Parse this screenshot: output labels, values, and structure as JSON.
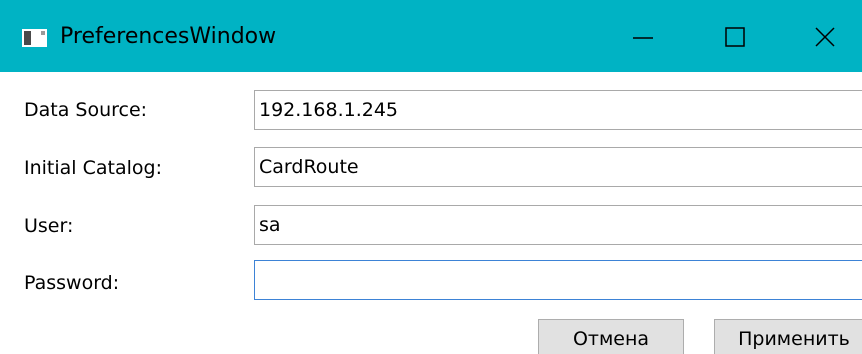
{
  "window": {
    "title": "PreferencesWindow",
    "accent_color": "#00b3c4",
    "controls": {
      "minimize_icon": "minimize-icon",
      "maximize_icon": "maximize-icon",
      "close_icon": "close-icon"
    }
  },
  "form": {
    "data_source": {
      "label": "Data Source:",
      "value": "192.168.1.245"
    },
    "initial_catalog": {
      "label": "Initial Catalog:",
      "value": "CardRoute"
    },
    "user": {
      "label": "User:",
      "value": "sa"
    },
    "password": {
      "label": "Password:",
      "value": ""
    }
  },
  "buttons": {
    "cancel_label": "Отмена",
    "apply_label": "Применить"
  }
}
